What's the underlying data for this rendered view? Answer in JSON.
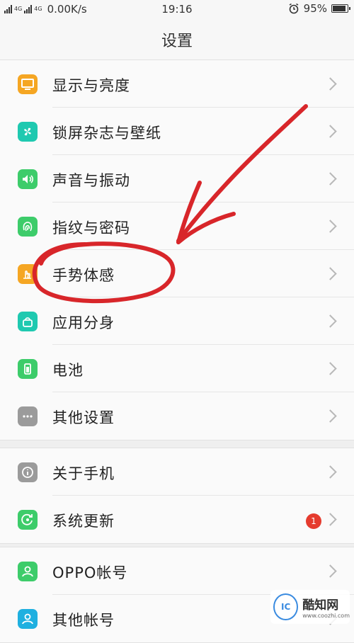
{
  "status_bar": {
    "network_left": "4G",
    "network_right": "4G",
    "speed": "0.00K/s",
    "time": "19:16",
    "battery_percent": "95%",
    "battery_level": 0.95
  },
  "header": {
    "title": "设置"
  },
  "groups": [
    {
      "items": [
        {
          "label": "显示与亮度",
          "icon": "display-icon",
          "color": "#f5a623"
        },
        {
          "label": "锁屏杂志与壁纸",
          "icon": "wallpaper-icon",
          "color": "#1fc9b0"
        },
        {
          "label": "声音与振动",
          "icon": "speaker-icon",
          "color": "#3dcc6a"
        },
        {
          "label": "指纹与密码",
          "icon": "fingerprint-icon",
          "color": "#3dcc6a"
        },
        {
          "label": "手势体感",
          "icon": "gesture-icon",
          "color": "#f5a623"
        },
        {
          "label": "应用分身",
          "icon": "app-clone-icon",
          "color": "#1fc9b0"
        },
        {
          "label": "电池",
          "icon": "battery-icon",
          "color": "#3dcc6a"
        },
        {
          "label": "其他设置",
          "icon": "more-icon",
          "color": "#9b9b9b"
        }
      ]
    },
    {
      "items": [
        {
          "label": "关于手机",
          "icon": "info-icon",
          "color": "#9b9b9b"
        },
        {
          "label": "系统更新",
          "icon": "update-icon",
          "color": "#3dcc6a",
          "badge": "1"
        }
      ]
    },
    {
      "items": [
        {
          "label": "OPPO帐号",
          "icon": "account-icon",
          "color": "#3dcc6a"
        },
        {
          "label": "其他帐号",
          "icon": "accounts-icon",
          "color": "#1fb0e0"
        }
      ]
    }
  ],
  "watermark": {
    "name": "酷知网",
    "url": "www.coozhi.com",
    "logo_text": "IC"
  },
  "annotation_color": "#d8262a"
}
